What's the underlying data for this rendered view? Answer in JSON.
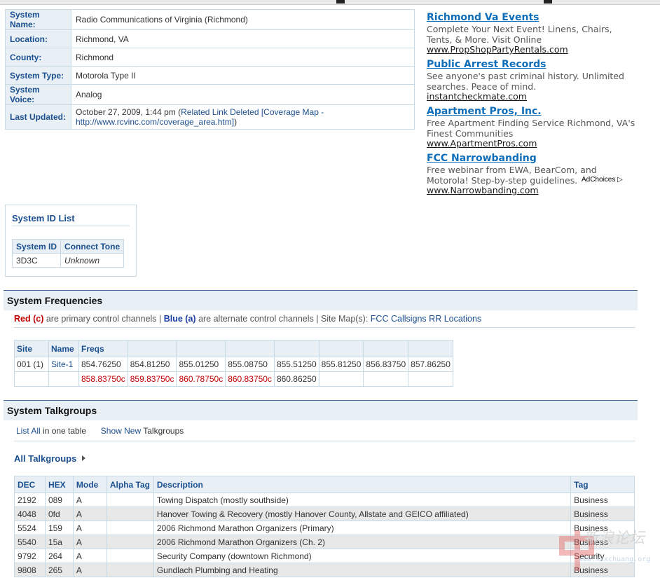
{
  "system_info": [
    {
      "key": "System Name:",
      "value": "Radio Communications of Virginia (Richmond)"
    },
    {
      "key": "Location:",
      "value": "Richmond, VA"
    },
    {
      "key": "County:",
      "value": "Richmond"
    },
    {
      "key": "System Type:",
      "value": "Motorola Type II"
    },
    {
      "key": "System Voice:",
      "value": "Analog"
    }
  ],
  "last_updated": {
    "key": "Last Updated:",
    "date": "October 27, 2009, 1:44 pm",
    "open": "(",
    "link": "Related Link Deleted [Coverage Map - http://www.rcvinc.com/coverage_area.htm]",
    "close": ")"
  },
  "ads": [
    {
      "title": "Richmond Va Events",
      "desc": "Complete Your Next Event! Linens, Chairs, Tents, & More. Visit Online",
      "url": "www.PropShopPartyRentals.com"
    },
    {
      "title": "Public Arrest Records",
      "desc": "See anyone's past criminal history. Unlimited searches. Peace of mind.",
      "url": "instantcheckmate.com"
    },
    {
      "title": "Apartment Pros, Inc.",
      "desc": "Free Apartment Finding Service Richmond, VA's Finest Communities",
      "url": "www.ApartmentPros.com"
    },
    {
      "title": "FCC Narrowbanding",
      "desc": "Free webinar from EWA, BearCom, and Motorola! Step-by-step guidelines.",
      "url": "www.Narrowbanding.com"
    }
  ],
  "adchoices": "AdChoices ▷",
  "system_id": {
    "heading": "System ID List",
    "headers": [
      "System ID",
      "Connect Tone"
    ],
    "rows": [
      [
        "3D3C",
        "Unknown"
      ]
    ]
  },
  "frequencies": {
    "heading": "System Frequencies",
    "legend": {
      "red": "Red (c)",
      "t1": " are primary control channels | ",
      "blue": "Blue (a)",
      "t2": " are alternate control channels | Site Map(s): ",
      "links": [
        "FCC Callsigns",
        "RR Locations"
      ]
    },
    "headers": [
      "Site",
      "Name",
      "Freqs"
    ],
    "site": "001 (1)",
    "name": "Site-1",
    "row1": [
      "854.76250",
      "854.81250",
      "855.01250",
      "855.08750",
      "855.51250",
      "855.81250",
      "856.83750",
      "857.86250"
    ],
    "row2": [
      "858.83750c",
      "859.83750c",
      "860.78750c",
      "860.83750c",
      "860.86250",
      "",
      "",
      ""
    ]
  },
  "talkgroups": {
    "heading": "System Talkgroups",
    "list_all": "List All",
    "list_all_suffix": " in one table",
    "show_new": "Show New",
    "show_new_suffix": " Talkgroups",
    "all_label": "All Talkgroups",
    "headers": [
      "DEC",
      "HEX",
      "Mode",
      "Alpha Tag",
      "Description",
      "Tag"
    ],
    "rows": [
      [
        "2192",
        "089",
        "A",
        "",
        "Towing Dispatch (mostly southside)",
        "Business"
      ],
      [
        "4048",
        "0fd",
        "A",
        "",
        "Hanover Towing & Recovery (mostly Hanover County, Allstate and GEICO affiliated)",
        "Business"
      ],
      [
        "5524",
        "159",
        "A",
        "",
        "2006 Richmond Marathon Organizers (Primary)",
        "Business"
      ],
      [
        "5540",
        "15a",
        "A",
        "",
        "2006 Richmond Marathon Organizers (Ch. 2)",
        "Business"
      ],
      [
        "9792",
        "264",
        "A",
        "",
        "Security Company (downtown Richmond)",
        "Security"
      ],
      [
        "9808",
        "265",
        "A",
        "",
        "Gundlach Plumbing and Heating",
        "Business"
      ]
    ]
  },
  "watermark": {
    "line1": "新浪论坛",
    "line2": "www.xxxchuang.org"
  },
  "colors": {
    "link": "#1b4f8f",
    "header_bg": "#e8f0f6",
    "border": "#c7d9e4",
    "control_red": "#c00000",
    "ad_title": "#0e6db8"
  }
}
